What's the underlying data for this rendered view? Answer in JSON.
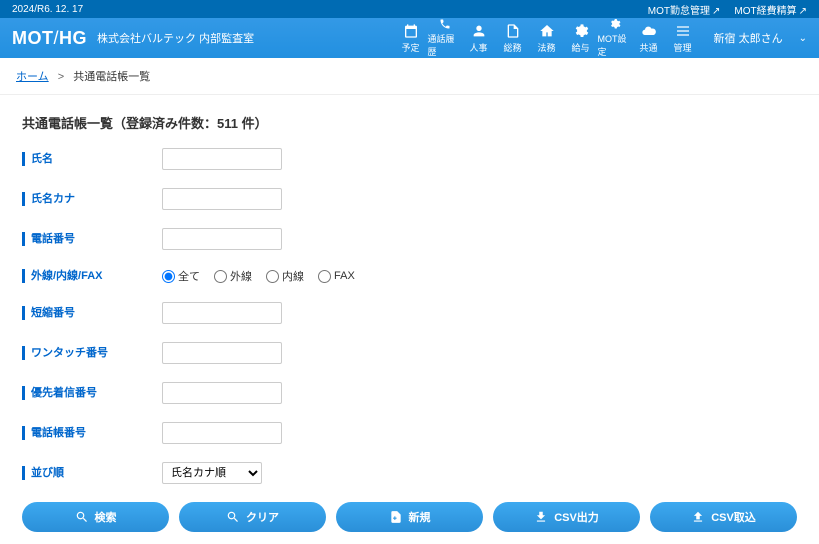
{
  "top": {
    "date": "2024/R6. 12. 17",
    "links": [
      "MOT勤怠管理",
      "MOT経費精算"
    ]
  },
  "header": {
    "logo_main": "MOT",
    "logo_slash": "/",
    "logo_sub": "HG",
    "company": "株式会社バルテック 内部監査室",
    "nav": [
      {
        "label": "予定"
      },
      {
        "label": "通話履歴"
      },
      {
        "label": "人事"
      },
      {
        "label": "総務"
      },
      {
        "label": "法務"
      },
      {
        "label": "給与"
      },
      {
        "label": "MOT設定"
      },
      {
        "label": "共通"
      },
      {
        "label": "管理"
      }
    ],
    "user": "新宿 太郎さん"
  },
  "breadcrumb": {
    "home": "ホーム",
    "current": "共通電話帳一覧"
  },
  "page": {
    "title": "共通電話帳一覧（登録済み件数：511 件）"
  },
  "form": {
    "name_label": "氏名",
    "kana_label": "氏名カナ",
    "phone_label": "電話番号",
    "line_label": "外線/内線/FAX",
    "line_options": [
      "全て",
      "外線",
      "内線",
      "FAX"
    ],
    "short_label": "短縮番号",
    "onetouch_label": "ワンタッチ番号",
    "priority_label": "優先着信番号",
    "book_label": "電話帳番号",
    "sort_label": "並び順",
    "sort_value": "氏名カナ順"
  },
  "buttons": {
    "search": "検索",
    "clear": "クリア",
    "new": "新規",
    "csv_out": "CSV出力",
    "csv_in": "CSV取込"
  }
}
